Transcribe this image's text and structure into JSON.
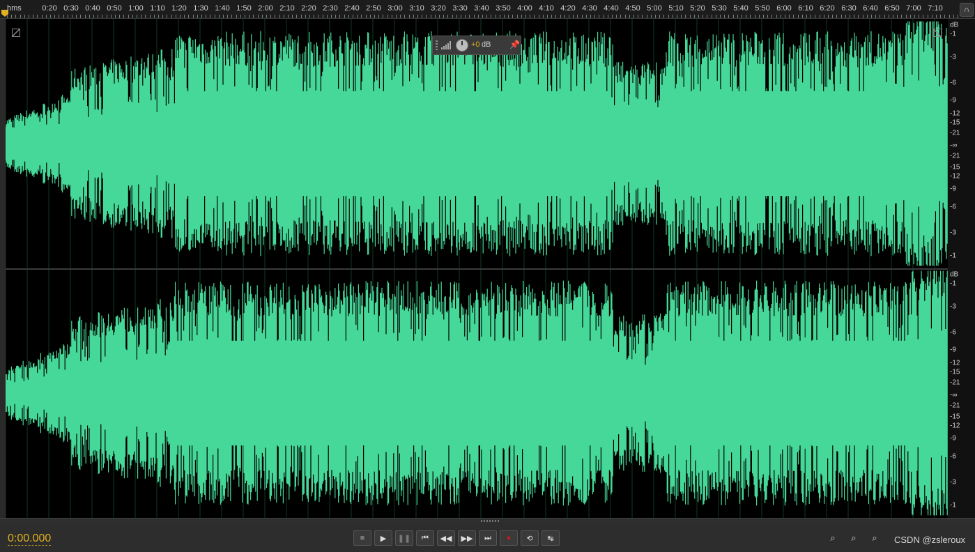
{
  "ruler": {
    "unit_label": "hms",
    "ticks": [
      "0:20",
      "0:30",
      "0:40",
      "0:50",
      "1:00",
      "1:10",
      "1:20",
      "1:30",
      "1:40",
      "1:50",
      "2:00",
      "2:10",
      "2:20",
      "2:30",
      "2:40",
      "2:50",
      "3:00",
      "3:10",
      "3:20",
      "3:30",
      "3:40",
      "3:50",
      "4:00",
      "4:10",
      "4:20",
      "4:30",
      "4:40",
      "4:50",
      "5:00",
      "5:10",
      "5:20",
      "5:30",
      "5:40",
      "5:50",
      "6:00",
      "6:10",
      "6:20",
      "6:30",
      "6:40",
      "6:50",
      "7:00",
      "7:10"
    ]
  },
  "hud": {
    "value": "+0",
    "unit": "dB"
  },
  "db_scale": {
    "title": "dB",
    "labels": [
      "-1",
      "-3",
      "-6",
      "-9",
      "-12",
      "-15",
      "-21",
      "-∞",
      "-21",
      "-15",
      "-12",
      "-9",
      "-6",
      "-3",
      "-1"
    ]
  },
  "transport": {
    "timecode": "0:00.000",
    "buttons": [
      "stop-icon",
      "play-icon",
      "pause-icon",
      "skip-start-icon",
      "rewind-icon",
      "fast-forward-icon",
      "skip-end-icon",
      "record-icon",
      "loop-icon",
      "skip-selection-icon"
    ]
  },
  "zoom": [
    "zoom-in-amplitude-icon",
    "zoom-out-amplitude-icon",
    "zoom-in-time-icon"
  ],
  "watermark": "CSDN @zsleroux",
  "colors": {
    "waveform": "#45d898",
    "background": "#000000",
    "accent": "#e0b020"
  }
}
